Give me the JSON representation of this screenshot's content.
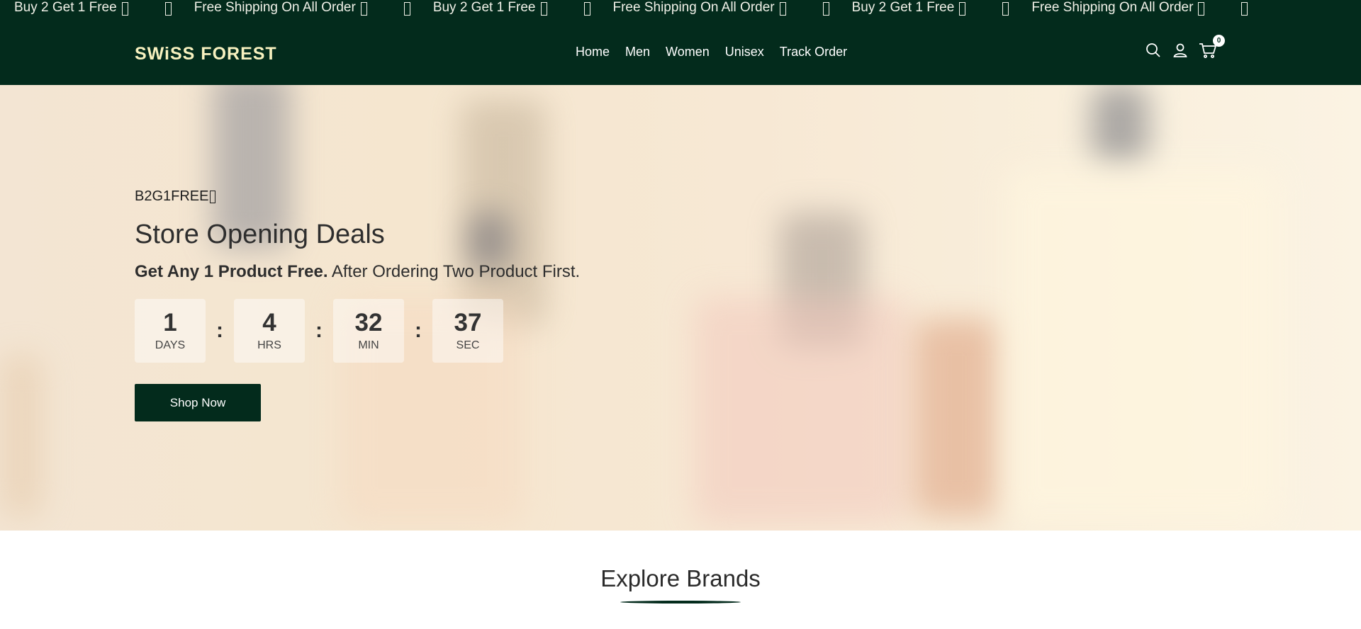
{
  "announcement": {
    "items": [
      {
        "text": "Buy 2 Get 1 Free"
      },
      {
        "text": "Free Shipping On All Order"
      },
      {
        "text": "Buy 2 Get 1 Free"
      },
      {
        "text": "Free Shipping On All Order"
      },
      {
        "text": "Buy 2 Get 1 Free"
      },
      {
        "text": "Free Shipping On All Order"
      }
    ]
  },
  "header": {
    "logo": "SWiSS FOREST",
    "nav": [
      "Home",
      "Men",
      "Women",
      "Unisex",
      "Track Order"
    ],
    "icons": [
      "search-icon",
      "user-icon",
      "cart-icon"
    ],
    "cart_count": "0"
  },
  "hero": {
    "promo_code": "B2G1FREE",
    "title": "Store Opening Deals",
    "subtitle_bold": "Get Any 1 Product Free.",
    "subtitle_rest": " After Ordering Two Product First.",
    "countdown": [
      {
        "value": "1",
        "label": "DAYS"
      },
      {
        "value": "4",
        "label": "HRS"
      },
      {
        "value": "32",
        "label": "MIN"
      },
      {
        "value": "37",
        "label": "SEC"
      }
    ],
    "cta": "Shop Now"
  },
  "brands": {
    "title": "Explore Brands"
  },
  "colors": {
    "brand_dark_green": "#032b1c",
    "logo_cream": "#f7f1bf"
  }
}
